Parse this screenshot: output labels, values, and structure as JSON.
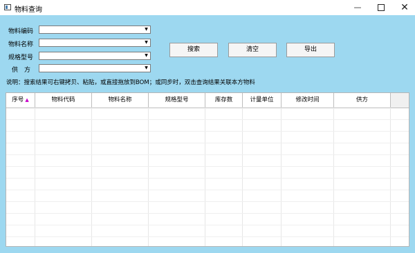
{
  "window": {
    "title": "物料查询",
    "minimize_symbol": "—",
    "close_symbol": "✕"
  },
  "form": {
    "code_label": "物料编码",
    "name_label": "物料名称",
    "spec_label": "规格型号",
    "supplier_label": "供　方",
    "dropdown_arrow": "▼"
  },
  "buttons": {
    "search": "搜索",
    "clear": "清空",
    "export": "导出"
  },
  "note": "说明：搜索结果可右键拷贝、粘贴，或直接拖放到BOM；或同步时，双击查询结果关联本方物料",
  "table": {
    "columns": [
      "序号",
      "物料代码",
      "物料名称",
      "规格型号",
      "库存数",
      "计量单位",
      "修改时间",
      "供方"
    ],
    "sort_indicator": "▲",
    "rows": []
  },
  "colors": {
    "background": "#9dd8f0",
    "sort_indicator": "#c800c8"
  }
}
